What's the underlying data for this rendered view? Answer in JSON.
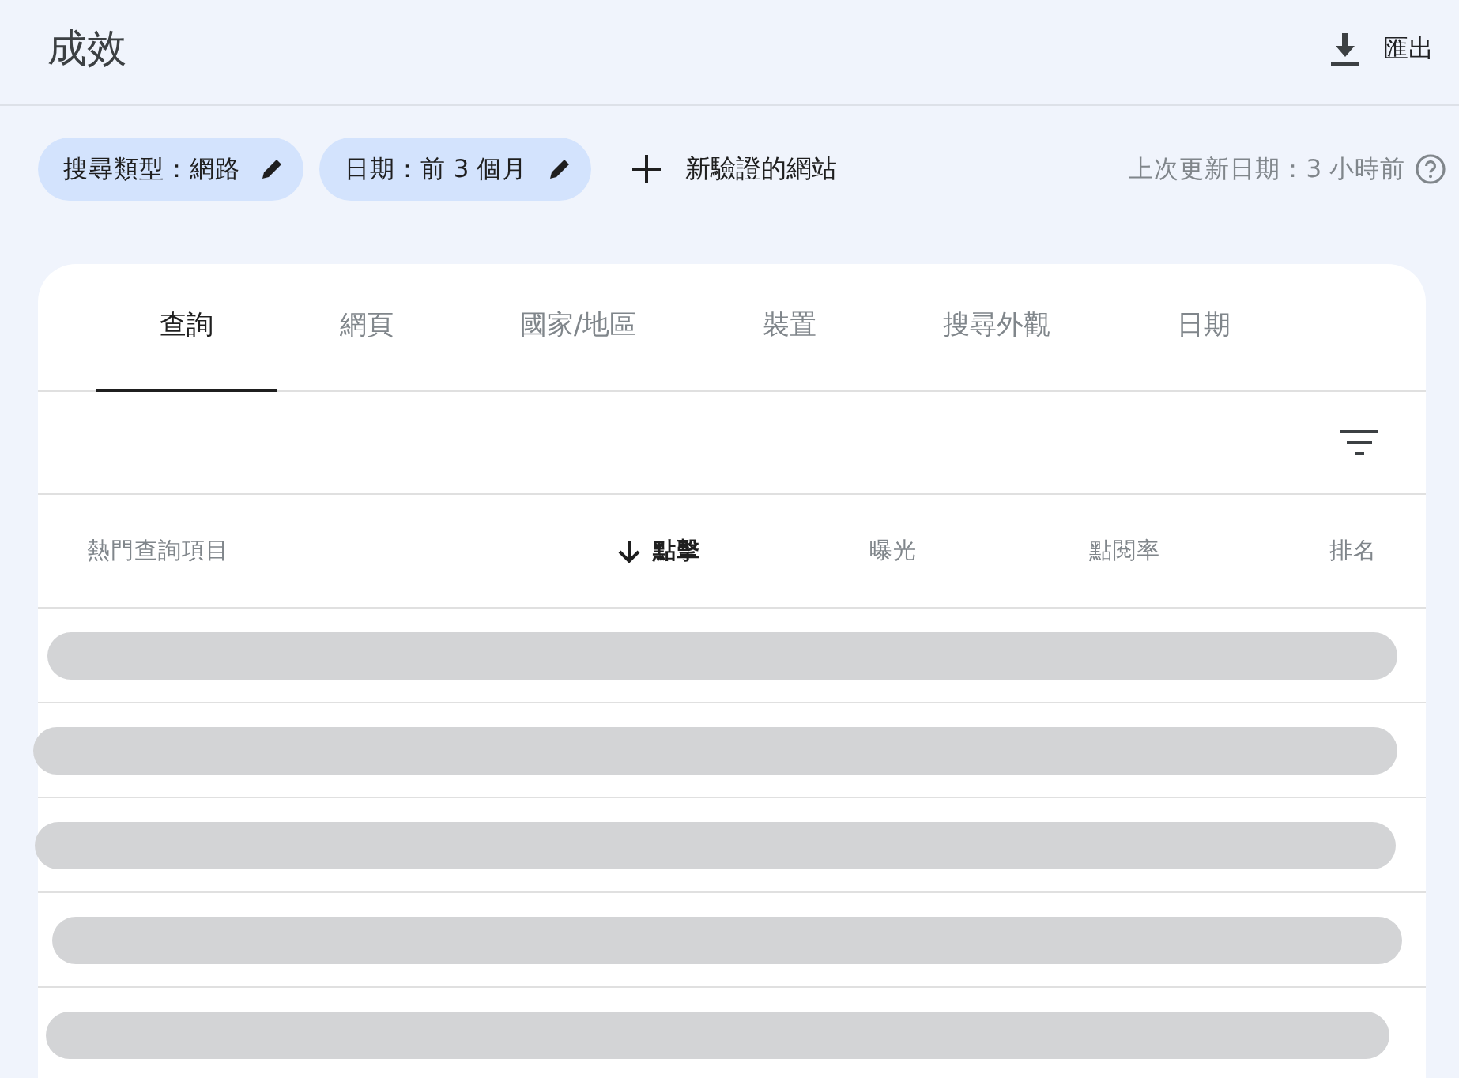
{
  "header": {
    "title": "成效",
    "export_label": "匯出"
  },
  "filters": [
    {
      "label": "搜尋類型：網路"
    },
    {
      "label": "日期：前 3 個月"
    }
  ],
  "add_filter": {
    "label": "新驗證的網站"
  },
  "last_update": "上次更新日期：3 小時前",
  "tabs": [
    {
      "label": "查詢",
      "selected": true
    },
    {
      "label": "網頁",
      "selected": false
    },
    {
      "label": "國家/地區",
      "selected": false
    },
    {
      "label": "裝置",
      "selected": false
    },
    {
      "label": "搜尋外觀",
      "selected": false
    },
    {
      "label": "日期",
      "selected": false
    }
  ],
  "table": {
    "columns": [
      {
        "label": "熱門查詢項目",
        "sorted": false
      },
      {
        "label": "點擊",
        "sorted": true
      },
      {
        "label": "曝光",
        "sorted": false
      },
      {
        "label": "點閱率",
        "sorted": false
      },
      {
        "label": "排名",
        "sorted": false
      }
    ],
    "loading_rows": [
      {
        "kind": "skeleton"
      },
      {
        "kind": "skeleton"
      },
      {
        "kind": "skeleton"
      },
      {
        "kind": "skeleton"
      },
      {
        "kind": "skeleton"
      }
    ]
  }
}
